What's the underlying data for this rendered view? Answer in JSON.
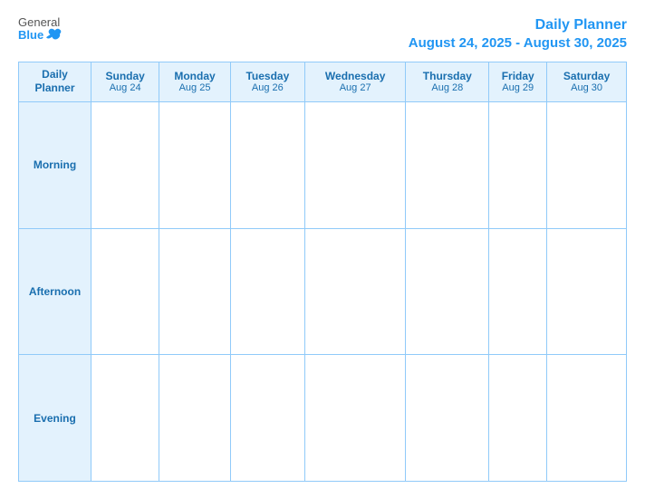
{
  "header": {
    "logo_general": "General",
    "logo_blue": "Blue",
    "title": "Daily Planner",
    "date_range": "August 24, 2025 - August 30, 2025"
  },
  "table": {
    "col_header_label": "Daily\nPlanner",
    "days": [
      {
        "name": "Sunday",
        "date": "Aug 24"
      },
      {
        "name": "Monday",
        "date": "Aug 25"
      },
      {
        "name": "Tuesday",
        "date": "Aug 26"
      },
      {
        "name": "Wednesday",
        "date": "Aug 27"
      },
      {
        "name": "Thursday",
        "date": "Aug 28"
      },
      {
        "name": "Friday",
        "date": "Aug 29"
      },
      {
        "name": "Saturday",
        "date": "Aug 30"
      }
    ],
    "rows": [
      {
        "label": "Morning"
      },
      {
        "label": "Afternoon"
      },
      {
        "label": "Evening"
      }
    ]
  }
}
